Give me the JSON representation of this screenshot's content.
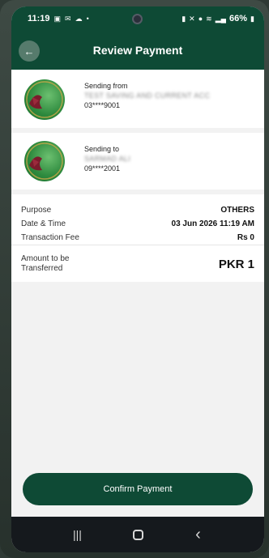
{
  "status_bar": {
    "time": "11:19",
    "icons": [
      "gallery-icon",
      "mail-icon",
      "cloud-icon",
      "dot-icon"
    ],
    "battery": "66%"
  },
  "header": {
    "title": "Review Payment",
    "back_icon": "←"
  },
  "sending_from": {
    "label": "Sending from",
    "name": "TEST SAVING AND CURRENT ACC",
    "account": "03****9001"
  },
  "sending_to": {
    "label": "Sending to",
    "name": "SARMAD ALI",
    "account": "09****2001"
  },
  "details": {
    "purpose_label": "Purpose",
    "purpose_value": "OTHERS",
    "datetime_label": "Date & Time",
    "datetime_value": "03 Jun 2026 11:19 AM",
    "fee_label": "Transaction Fee",
    "fee_value": "Rs 0",
    "amount_label": "Amount to be Transferred",
    "amount_value": "PKR 1"
  },
  "actions": {
    "confirm_label": "Confirm Payment"
  },
  "nav": {
    "recents": "|||",
    "back": "‹"
  },
  "colors": {
    "brand_green": "#0e4a35",
    "background": "#f2f2f2"
  }
}
